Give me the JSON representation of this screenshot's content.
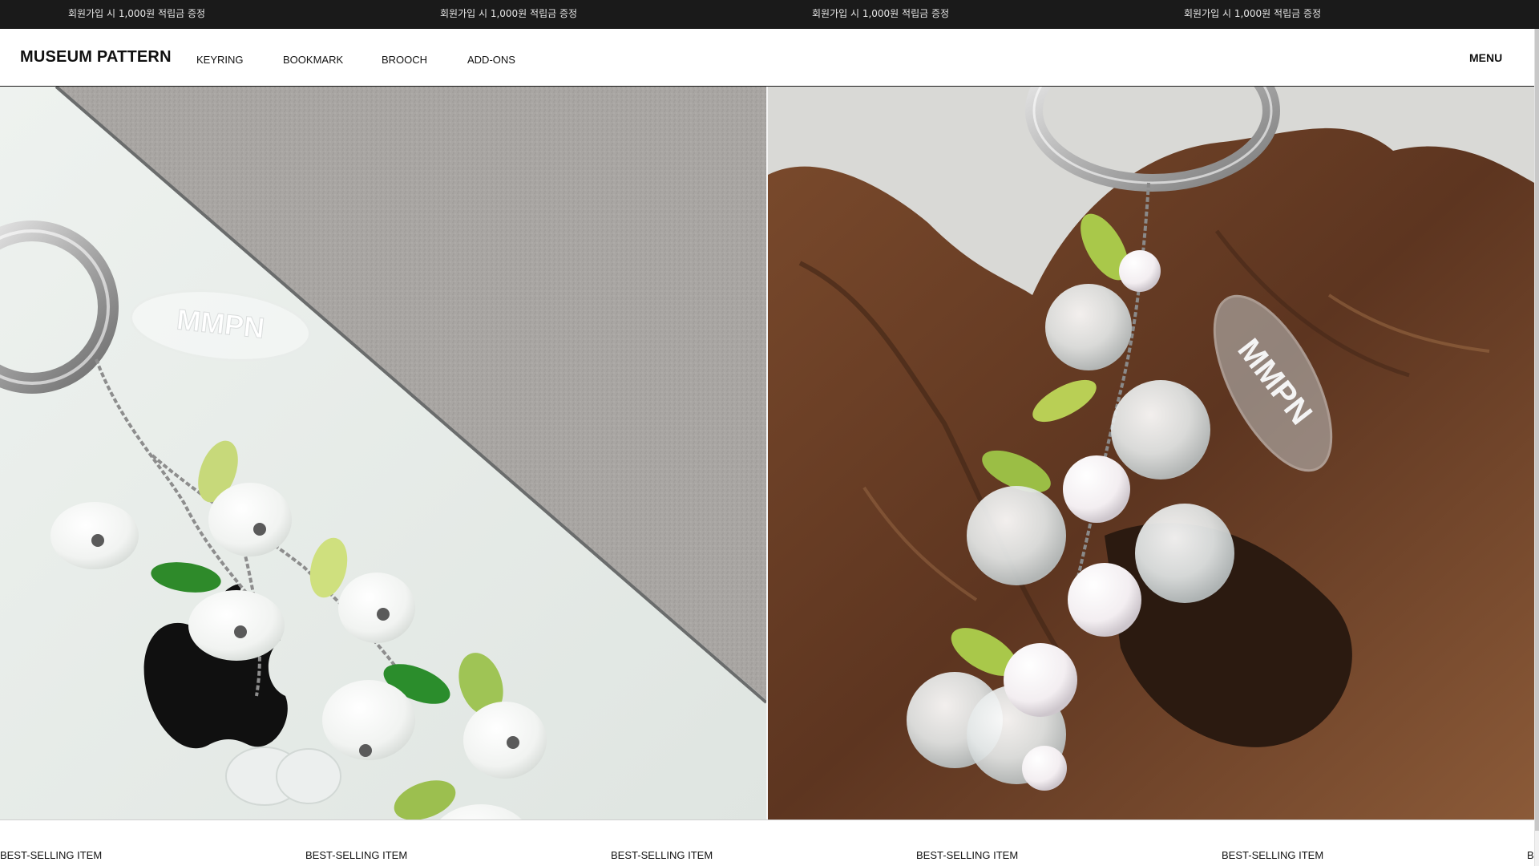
{
  "announcement": {
    "messages": [
      "회원가입 시 1,000원 적립금 증정",
      "회원가입 시 1,000원 적립금 증정",
      "회원가입 시 1,000원 적립금 증정",
      "회원가입 시 1,000원 적립금 증정"
    ]
  },
  "header": {
    "logo": "MUSEUM PATTERN",
    "nav": [
      "KEYRING",
      "BOOKMARK",
      "BROOCH",
      "ADD-ONS"
    ],
    "menu_label": "MENU"
  },
  "hero": {
    "slides": [
      {
        "image": "lily-of-the-valley-keyring-on-white-phone-case",
        "tag_text": "MMPN"
      },
      {
        "image": "frosted-grape-bead-keyring-on-driftwood",
        "tag_text": "MMPN"
      }
    ]
  },
  "best_selling": {
    "labels": [
      "BEST-SELLING ITEM",
      "BEST-SELLING ITEM",
      "BEST-SELLING ITEM",
      "BEST-SELLING ITEM",
      "BEST-SELLING ITEM",
      "B"
    ]
  },
  "colors": {
    "announcement_bg": "#1a1a1a",
    "header_bg": "#ffffff",
    "text": "#111111"
  }
}
